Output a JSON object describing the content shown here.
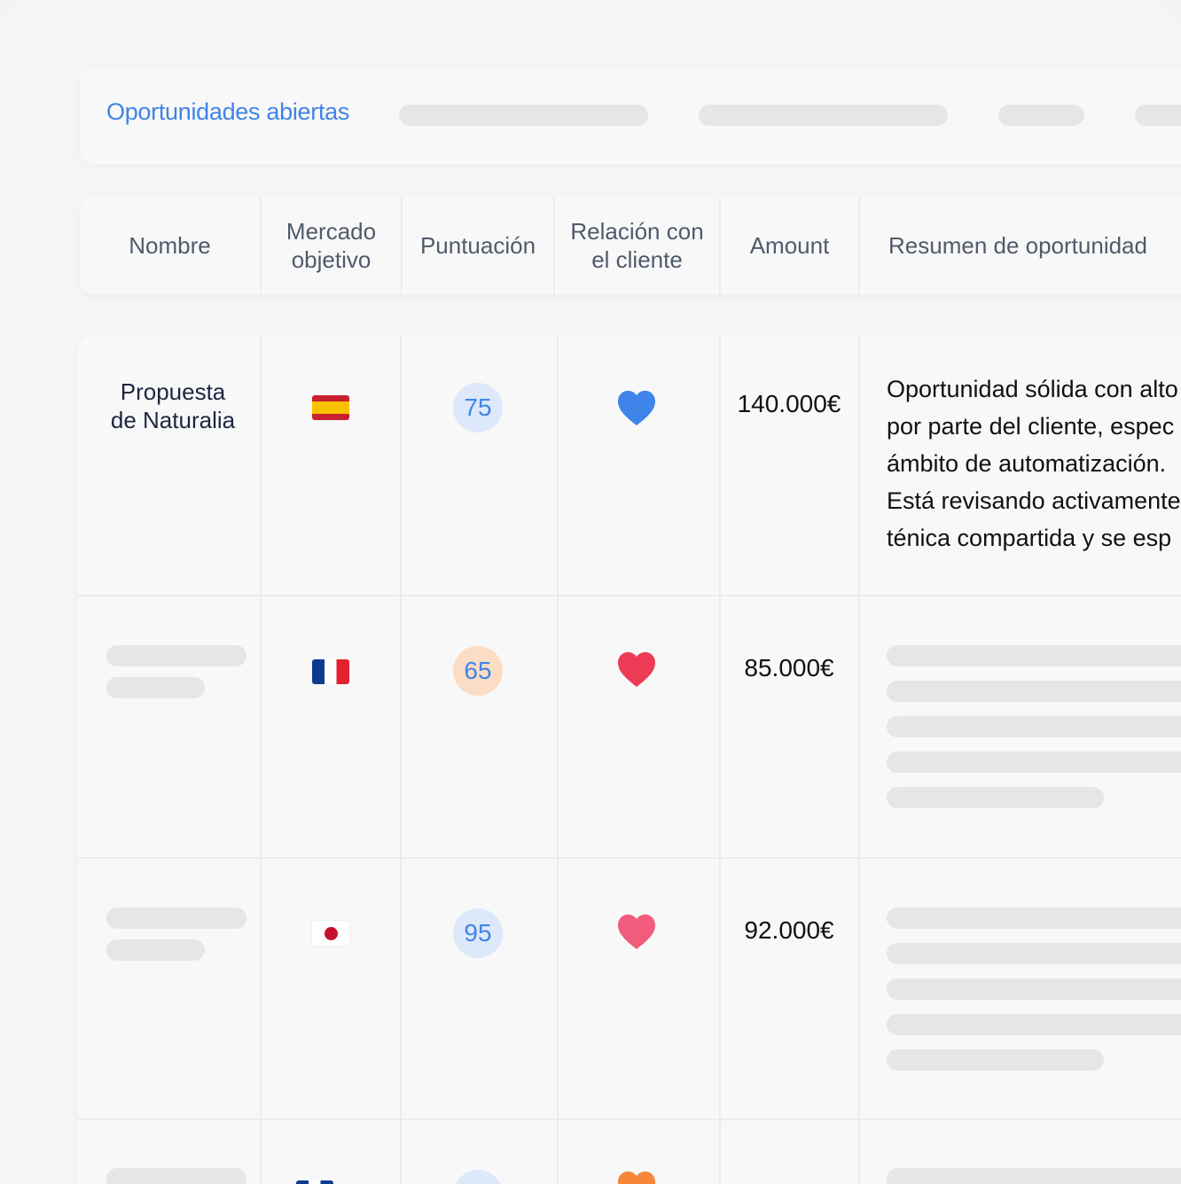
{
  "page": {
    "title": "Oportunidades abiertas"
  },
  "colors": {
    "accent": "#3f84e8",
    "score_blue_bg": "#dde8fa",
    "score_orange_bg": "#fbdcc4",
    "heart_blue": "#3f84e8",
    "heart_red": "#ee3b55",
    "heart_pink": "#f25c7c",
    "heart_orange": "#f6873a"
  },
  "table": {
    "columns": [
      "Nombre",
      "Mercado\nobjetivo",
      "Puntuación",
      "Relación con\nel cliente",
      "Amount",
      "Resumen de oportunidad"
    ],
    "rows": [
      {
        "name": "Propuesta\nde Naturalia",
        "flag": "spain-flag-icon",
        "score": "75",
        "relationship": "blue-heart-icon",
        "amount": "140.000€",
        "summary": [
          "Oportunidad sólida con alto",
          "por parte del cliente, espec",
          "ámbito de automatización.",
          "Está revisando activamente",
          "ténica compartida y se esp"
        ]
      },
      {
        "name": "",
        "flag": "france-flag-icon",
        "score": "65",
        "relationship": "red-heart-icon",
        "amount": "85.000€"
      },
      {
        "name": "",
        "flag": "japan-flag-icon",
        "score": "95",
        "relationship": "pink-heart-icon",
        "amount": "92.000€"
      },
      {
        "name": "",
        "flag": "flag-icon",
        "score": "",
        "relationship": "orange-heart-icon",
        "amount": ""
      }
    ]
  }
}
